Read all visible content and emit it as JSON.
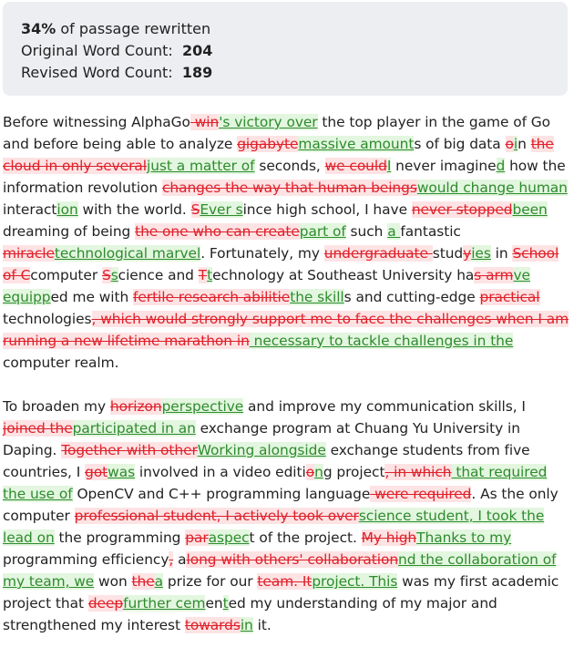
{
  "stats": {
    "percent": "34%",
    "percent_label": " of passage rewritten",
    "orig_label": "Original Word Count:",
    "orig_value": "204",
    "rev_label": "Revised Word Count:",
    "rev_value": "189"
  },
  "paragraphs": [
    [
      {
        "t": "Before witnessing AlphaGo"
      },
      {
        "d": " win"
      },
      {
        "i": "'s victory over"
      },
      {
        "t": " the top player in the game of Go and before being able to analyze "
      },
      {
        "d": "gigabyte"
      },
      {
        "i": "massive amount"
      },
      {
        "t": "s of big data "
      },
      {
        "d": "o"
      },
      {
        "i": "i"
      },
      {
        "t": "n "
      },
      {
        "d": "the cloud in only several"
      },
      {
        "i": "just a matter of"
      },
      {
        "t": " seconds, "
      },
      {
        "d": "we could"
      },
      {
        "i": "I"
      },
      {
        "t": " never imagine"
      },
      {
        "i": "d"
      },
      {
        "t": " how the information revolution "
      },
      {
        "d": "changes the way that human beings"
      },
      {
        "i": "would change human"
      },
      {
        "t": " interact"
      },
      {
        "i": "ion"
      },
      {
        "t": " with the world. "
      },
      {
        "d": "S"
      },
      {
        "i": "Ever s"
      },
      {
        "t": "ince high school, I have "
      },
      {
        "d": "never stopped"
      },
      {
        "i": "been"
      },
      {
        "t": " dreaming of being "
      },
      {
        "d": "the one who can create"
      },
      {
        "i": "part of"
      },
      {
        "t": " such "
      },
      {
        "i": "a "
      },
      {
        "t": "fantastic "
      },
      {
        "d": "miracle"
      },
      {
        "i": "technological marvel"
      },
      {
        "t": ". Fortunately, my "
      },
      {
        "d": "undergraduate "
      },
      {
        "t": "stud"
      },
      {
        "d": "y"
      },
      {
        "i": "ies"
      },
      {
        "t": " in "
      },
      {
        "d": "School of C"
      },
      {
        "t": "computer "
      },
      {
        "d": "S"
      },
      {
        "i": "s"
      },
      {
        "t": "cience and "
      },
      {
        "d": "T"
      },
      {
        "i": "t"
      },
      {
        "t": "echnology at Southeast University ha"
      },
      {
        "d": "s arm"
      },
      {
        "i": "ve equipp"
      },
      {
        "t": "ed me with "
      },
      {
        "d": "fertile research abilitie"
      },
      {
        "i": "the skill"
      },
      {
        "t": "s and cutting-edge "
      },
      {
        "d": "practical "
      },
      {
        "t": "technologies"
      },
      {
        "d": ", which would strongly support me to face the challenges when I am running a new lifetime marathon in"
      },
      {
        "i": " necessary to tackle challenges in the"
      },
      {
        "t": " computer realm."
      }
    ],
    [
      {
        "t": "To broaden my "
      },
      {
        "d": "horizon"
      },
      {
        "i": "perspective"
      },
      {
        "t": " and improve my communication skills, I "
      },
      {
        "d": "joined the"
      },
      {
        "i": "participated in an"
      },
      {
        "t": " exchange program at Chuang Yu University in Daping. "
      },
      {
        "d": "Together with other"
      },
      {
        "i": "Working alongside"
      },
      {
        "t": " exchange students from five countries, I "
      },
      {
        "d": "got"
      },
      {
        "i": "was"
      },
      {
        "t": " involved in a video editi"
      },
      {
        "d": "o"
      },
      {
        "i": "n"
      },
      {
        "t": "g project"
      },
      {
        "d": ", in which"
      },
      {
        "i": " that required the use of"
      },
      {
        "t": " OpenCV and C++ programming language"
      },
      {
        "d": " were required"
      },
      {
        "t": ". As the only computer "
      },
      {
        "d": "professional student, I actively took over"
      },
      {
        "i": "science student, I took the lead on"
      },
      {
        "t": " the programming "
      },
      {
        "d": "par"
      },
      {
        "i": "aspec"
      },
      {
        "t": "t of the project. "
      },
      {
        "d": "My high"
      },
      {
        "i": "Thanks to my"
      },
      {
        "t": " programming efficiency"
      },
      {
        "d": ","
      },
      {
        "t": " a"
      },
      {
        "d": "long with others' collaboration"
      },
      {
        "i": "nd the collaboration of my team, we"
      },
      {
        "t": " won "
      },
      {
        "d": "the"
      },
      {
        "i": "a"
      },
      {
        "t": " prize for our "
      },
      {
        "d": "team. It"
      },
      {
        "i": "project. This"
      },
      {
        "t": " was my first academic project that "
      },
      {
        "d": "deep"
      },
      {
        "i": "further cem"
      },
      {
        "t": "en"
      },
      {
        "i": "t"
      },
      {
        "t": "ed my understanding of my major and strengthened my interest "
      },
      {
        "d": "towards"
      },
      {
        "i": "in"
      },
      {
        "t": " it."
      }
    ]
  ]
}
